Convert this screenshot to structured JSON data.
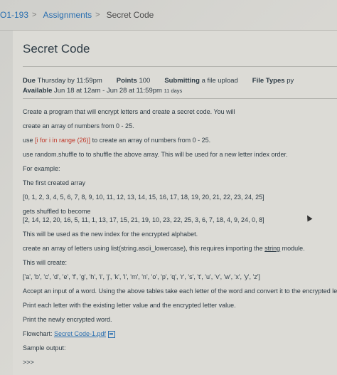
{
  "breadcrumb": {
    "course": "O1-193",
    "assignments": "Assignments",
    "current": "Secret Code",
    "separator": ">"
  },
  "page": {
    "title": "Secret Code"
  },
  "meta": {
    "due_label": "Due",
    "due_value": "Thursday by 11:59pm",
    "points_label": "Points",
    "points_value": "100",
    "submitting_label": "Submitting",
    "submitting_value": "a file upload",
    "filetypes_label": "File Types",
    "filetypes_value": "py",
    "available_label": "Available",
    "available_value": "Jun 18 at 12am - Jun 28 at 11:59pm",
    "available_days": "11 days"
  },
  "description": {
    "l1": "Create a program that will encrypt letters and create a secret code.  You will",
    "l2": "create an array of numbers from 0 - 25.",
    "l3_pre": "use ",
    "l3_code": "[i for i in range (26)]",
    "l3_post": " to create an array of numbers from 0 - 25.",
    "l4": "use random.shuffle to to shuffle the above array.  This will be used for a new letter index order.",
    "l5": "For example:",
    "l6": "The first created array",
    "l7": "[0, 1, 2, 3, 4, 5, 6, 7, 8, 9, 10, 11, 12, 13, 14, 15, 16, 17, 18, 19, 20, 21, 22, 23, 24, 25]",
    "l8": "gets shuffled to become",
    "l9": "[2, 14, 12, 20, 16, 5, 11, 1, 13, 17, 15, 21, 19, 10, 23, 22, 25, 3, 6, 7, 18, 4, 9, 24, 0, 8]",
    "l10": "This will be used as the new index for the encrypted alphabet.",
    "l11_pre": "create an array of letters using list(string.ascii_lowercase), this requires importing  the ",
    "l11_link": "string",
    "l11_post": " module.",
    "l12": "This will create:",
    "l13": "['a', 'b', 'c', 'd', 'e', 'f', 'g', 'h', 'i', 'j', 'k', 'l', 'm', 'n', 'o', 'p', 'q', 'r', 's', 't', 'u', 'v', 'w', 'x', 'y', 'z']",
    "l14": "Accept an input of a word.  Using the above tables take each letter of the word and convert it to the encrypted le",
    "l15": "Print each letter with the existing letter value and the encrypted letter value.",
    "l16": "Print the newly encrypted word.",
    "l17_pre": "Flowchart: ",
    "l17_link": "Secret Code-1.pdf",
    "l18": "Sample output:",
    "l19": ">>>"
  },
  "icons": {
    "file": "pdf-file-icon"
  },
  "colors": {
    "link": "#2a6fb0",
    "code": "#c0392b"
  }
}
